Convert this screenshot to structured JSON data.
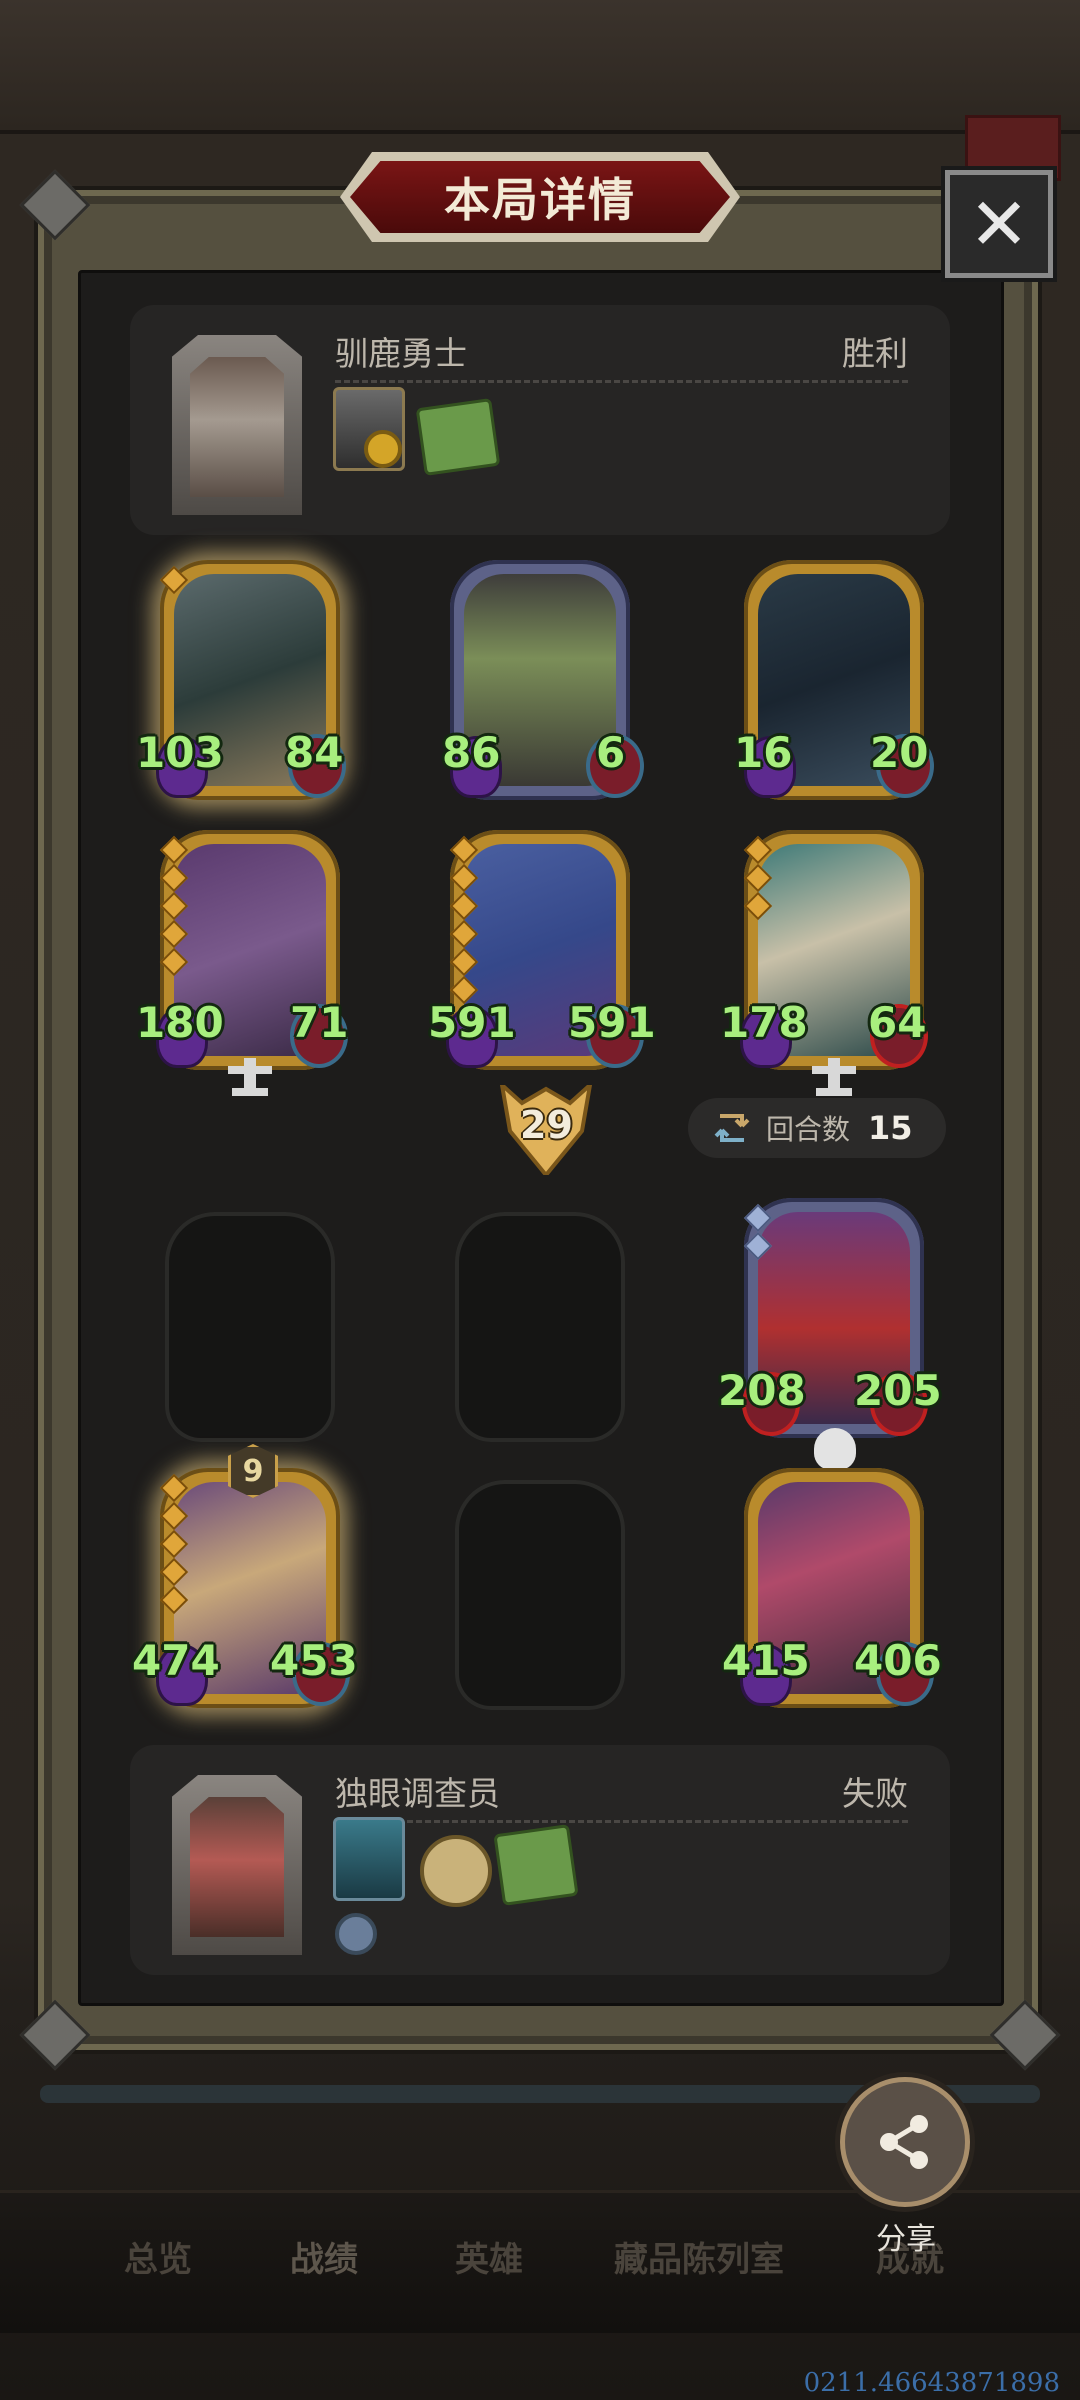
{
  "dialog": {
    "title": "本局详情",
    "close_icon": "close-icon"
  },
  "top_player": {
    "name": "驯鹿勇士",
    "result": "胜利",
    "items": [
      "helmet-coin-item-icon",
      "green-book-item-icon"
    ]
  },
  "top_board": [
    {
      "attack": "103",
      "health": "84",
      "frame": "gold",
      "tier_dots": 1
    },
    {
      "attack": "86",
      "health": "6",
      "frame": "blue",
      "tier_dots": 0
    },
    {
      "attack": "16",
      "health": "20",
      "frame": "gold",
      "tier_dots": 0
    },
    {
      "attack": "180",
      "health": "71",
      "frame": "gold",
      "tier_dots": 5
    },
    {
      "attack": "591",
      "health": "591",
      "frame": "gold",
      "tier_dots": 6
    },
    {
      "attack": "178",
      "health": "64",
      "frame": "gold",
      "tier_dots": 3
    }
  ],
  "damage": "29",
  "turn": {
    "label": "回合数",
    "value": "15"
  },
  "bottom_board": [
    {
      "attack": "208",
      "health": "205",
      "frame": "blue",
      "tier_dots": 2
    },
    {
      "attack": "474",
      "health": "453",
      "frame": "gold",
      "tier_dots": 5,
      "level": "9"
    },
    {
      "attack": "415",
      "health": "406",
      "frame": "gold",
      "tier_dots": 0
    }
  ],
  "bottom_player": {
    "name": "独眼调查员",
    "result": "失败",
    "items": [
      "blue-gem-item-icon",
      "gold-coin-item-icon",
      "green-book-item-icon",
      "sword-badge-item-icon"
    ]
  },
  "share": {
    "label": "分享",
    "icon": "share-icon"
  },
  "nav": {
    "tabs": [
      "总览",
      "战绩",
      "英雄",
      "藏品陈列室",
      "成就"
    ],
    "active": "战绩"
  },
  "device_id": "0211.46643871898",
  "colors": {
    "stat_green": "#a8ef7e",
    "gold_frame": "#b98b2c",
    "title_red": "#7a1515"
  }
}
